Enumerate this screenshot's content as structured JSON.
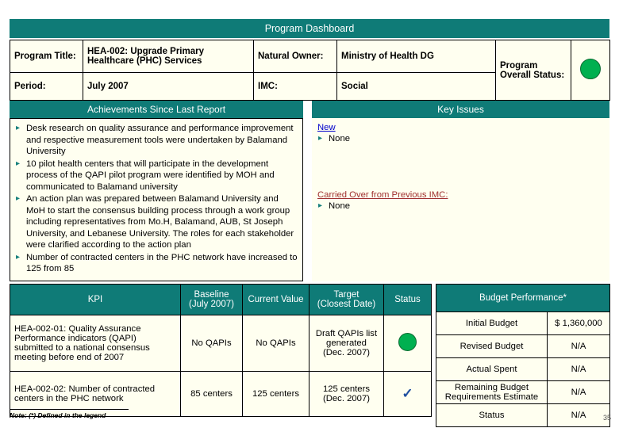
{
  "slide": {
    "title": "Program Dashboard",
    "page_number": "35",
    "note": "Note: (*) Defined in the legend",
    "accent_color": "#0F7B77",
    "panel_color": "#FFFFF0",
    "status_green": "#00B050"
  },
  "header": {
    "program_title_label": "Program Title:",
    "program_title_value": "HEA-002: Upgrade Primary Healthcare (PHC) Services",
    "natural_owner_label": "Natural Owner:",
    "natural_owner_value": "Ministry of Health DG",
    "period_label": "Period:",
    "period_value": "July 2007",
    "imc_label": "IMC:",
    "imc_value": "Social",
    "overall_status_label": "Program Overall Status:",
    "overall_status_icon": "green-circle"
  },
  "achievements": {
    "header": "Achievements Since Last Report",
    "items": [
      "Desk research on quality assurance and performance improvement and respective measurement  tools were undertaken by Balamand University",
      "10 pilot health centers that will participate in the development process of the QAPI pilot  program were identified by MOH and communicated to Balamand university",
      "An action plan was prepared between Balamand University and MoH to start the consensus building process through a work group including representatives from Mo.H, Balamand, AUB, St Joseph University, and Lebanese University. The roles for each stakeholder were clarified according to the action plan",
      "Number of contracted centers in the PHC network have increased to 125 from 85"
    ]
  },
  "key_issues": {
    "header": "Key Issues",
    "new_label": "New",
    "new_items": [
      "None"
    ],
    "carried_label": "Carried Over from Previous IMC:",
    "carried_items": [
      "None"
    ]
  },
  "kpi_table": {
    "columns": [
      "KPI",
      "Baseline\n(July 2007)",
      "Current Value",
      "Target\n(Closest Date)",
      "Status"
    ],
    "col_kpi": "KPI",
    "col_baseline_l1": "Baseline",
    "col_baseline_l2": "(July 2007)",
    "col_current": "Current Value",
    "col_target_l1": "Target",
    "col_target_l2": "(Closest Date)",
    "col_status": "Status",
    "rows": [
      {
        "kpi": "HEA-002-01: Quality Assurance Performance indicators (QAPI) submitted to a national consensus meeting before end of 2007",
        "baseline": "No QAPIs",
        "current": "No QAPIs",
        "target_l1": "Draft QAPIs list generated",
        "target_l2": "(Dec. 2007)",
        "status_icon": "green-circle"
      },
      {
        "kpi": "HEA-002-02: Number of contracted centers in the PHC network",
        "baseline": "85 centers",
        "current": "125 centers",
        "target_l1": "125 centers",
        "target_l2": "(Dec. 2007)",
        "status_icon": "blue-checkmark"
      }
    ]
  },
  "budget_table": {
    "header": "Budget Performance*",
    "rows": [
      {
        "label": "Initial Budget",
        "value": "$ 1,360,000"
      },
      {
        "label": "Revised Budget",
        "value": "N/A"
      },
      {
        "label": "Actual Spent",
        "value": "N/A"
      },
      {
        "label": "Remaining Budget Requirements Estimate",
        "value": "N/A"
      },
      {
        "label": "Status",
        "value": "N/A"
      }
    ]
  }
}
